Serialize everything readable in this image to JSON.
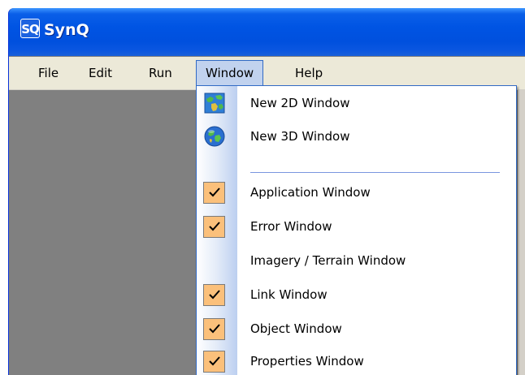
{
  "window": {
    "title": "SynQ",
    "icon_text": "SQ"
  },
  "menubar": {
    "items": [
      {
        "label": "File"
      },
      {
        "label": "Edit"
      },
      {
        "label": "Run"
      },
      {
        "label": "Window",
        "active": true
      },
      {
        "label": "Help"
      }
    ]
  },
  "window_menu": {
    "items": [
      {
        "label": "New 2D Window",
        "icon": "map-icon"
      },
      {
        "label": "New 3D Window",
        "icon": "globe-icon"
      },
      {
        "label": "Application Window",
        "checked": true
      },
      {
        "label": "Error Window",
        "checked": true
      },
      {
        "label": "Imagery / Terrain Window",
        "checked": false
      },
      {
        "label": "Link Window",
        "checked": true
      },
      {
        "label": "Object Window",
        "checked": true
      },
      {
        "label": "Properties Window",
        "checked": true
      }
    ]
  },
  "colors": {
    "titlebar": "#0054e3",
    "menubar": "#ece9d8",
    "highlight": "#c1d2ee",
    "check_bg": "#fbc07b",
    "workspace": "#808080"
  }
}
